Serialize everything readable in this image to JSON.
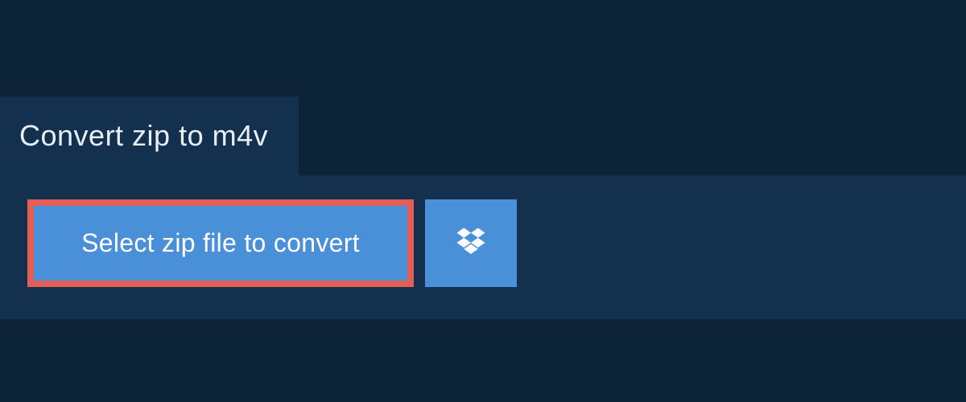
{
  "header": {
    "title": "Convert zip to m4v"
  },
  "actions": {
    "select_file_label": "Select zip file to convert",
    "dropbox_icon": "dropbox-icon"
  },
  "colors": {
    "accent": "#4a90d9",
    "highlight_border": "#e35f56",
    "panel_bg": "#13314f",
    "page_bg": "#0d2438"
  }
}
